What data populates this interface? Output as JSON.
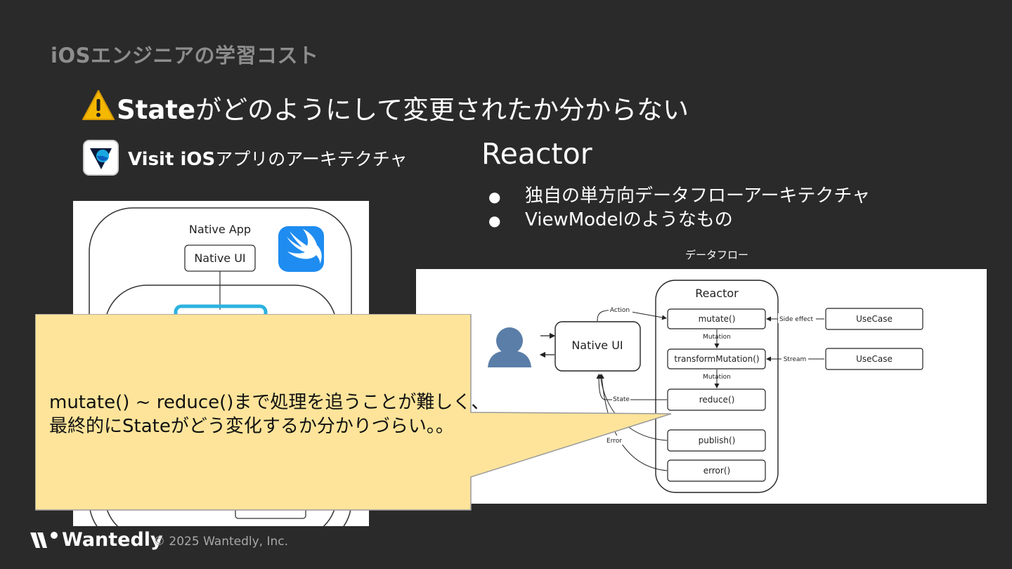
{
  "slide": {
    "section_title": "iOSエンジニアの学習コスト",
    "headline_bold": "State",
    "headline_rest": "がどのようにして変更されたか分からない",
    "app_heading_bold": "Visit iOS",
    "app_heading_rest": "アプリのアーキテクチャ",
    "reactor_title": "Reactor",
    "bullets": [
      "独自の単方向データフローアーキテクチャ",
      "ViewModelのようなもの"
    ],
    "bullet_marker": "●",
    "flow_caption": "データフロー"
  },
  "left_diagram": {
    "native_app_label": "Native App",
    "native_ui_label": "Native UI"
  },
  "flow_diagram": {
    "reactor_label": "Reactor",
    "native_ui": "Native UI",
    "methods": [
      "mutate()",
      "transformMutation()",
      "reduce()",
      "publish()",
      "error()"
    ],
    "usecase_1": "UseCase",
    "usecase_2": "UseCase",
    "edge_action": "Action",
    "edge_state": "State",
    "edge_error": "Error",
    "edge_mutation_1": "Mutation",
    "edge_mutation_2": "Mutation",
    "edge_side_effect": "Side effect",
    "edge_stream": "Stream"
  },
  "callout": {
    "line1": "mutate() ~ reduce()まで処理を追うことが難しく、",
    "line2": "最終的にStateがどう変化するか分かりづらい。。"
  },
  "footer": {
    "brand": "Wantedly",
    "copyright": "© 2025 Wantedly, Inc."
  },
  "colors": {
    "background": "#2a2a2a",
    "callout_fill": "#fde49a",
    "swift_orange": "#1e8cf0",
    "warning_yellow": "#f5b800"
  }
}
